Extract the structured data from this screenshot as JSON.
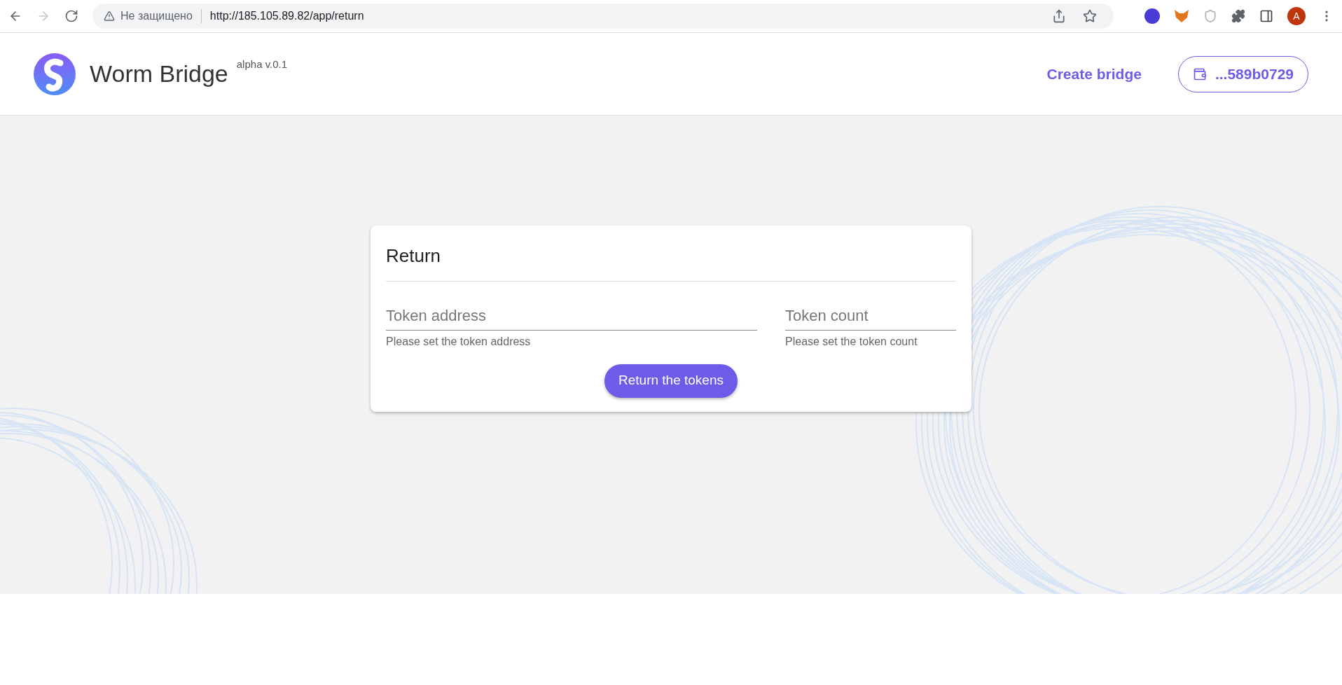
{
  "browser": {
    "forward_disabled": true,
    "security_label": "Не защищено",
    "url": "http://185.105.89.82/app/return",
    "profile_initial": "A"
  },
  "header": {
    "app_name": "Worm Bridge",
    "version": "alpha v.0.1",
    "nav_link": "Create bridge",
    "wallet": "...589b0729"
  },
  "card": {
    "title": "Return",
    "fields": [
      {
        "placeholder": "Token address",
        "helper": "Please set the token address"
      },
      {
        "placeholder": "Token count",
        "helper": "Please set the token count"
      }
    ],
    "submit": "Return the tokens"
  }
}
